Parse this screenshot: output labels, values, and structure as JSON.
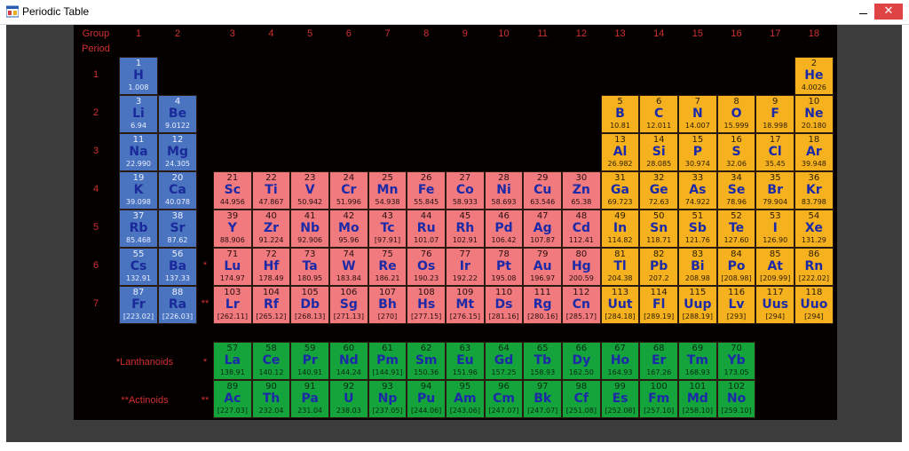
{
  "window": {
    "title": "Periodic Table",
    "close_glyph": "✕"
  },
  "labels": {
    "group": "Group",
    "period": "Period",
    "lanthanoids": "*Lanthanoids",
    "actinoids": "**Actinoids",
    "lan_marker": "*",
    "act_marker": "**"
  },
  "groups": [
    "1",
    "2",
    "3",
    "4",
    "5",
    "6",
    "7",
    "8",
    "9",
    "10",
    "11",
    "12",
    "13",
    "14",
    "15",
    "16",
    "17",
    "18"
  ],
  "periods": [
    "1",
    "2",
    "3",
    "4",
    "5",
    "6",
    "7"
  ],
  "colors": {
    "s_block": "#4a73c0",
    "d_block": "#f07a7e",
    "p_block": "#f6b21e",
    "f_block": "#15a33c",
    "background": "#050000",
    "label": "#d03030"
  },
  "elements": [
    {
      "n": "1",
      "s": "H",
      "m": "1.008",
      "g": 1,
      "p": 1,
      "b": "s"
    },
    {
      "n": "2",
      "s": "He",
      "m": "4.0026",
      "g": 18,
      "p": 1,
      "b": "p"
    },
    {
      "n": "3",
      "s": "Li",
      "m": "6.94",
      "g": 1,
      "p": 2,
      "b": "s"
    },
    {
      "n": "4",
      "s": "Be",
      "m": "9.0122",
      "g": 2,
      "p": 2,
      "b": "s"
    },
    {
      "n": "5",
      "s": "B",
      "m": "10.81",
      "g": 13,
      "p": 2,
      "b": "p"
    },
    {
      "n": "6",
      "s": "C",
      "m": "12.011",
      "g": 14,
      "p": 2,
      "b": "p"
    },
    {
      "n": "7",
      "s": "N",
      "m": "14.007",
      "g": 15,
      "p": 2,
      "b": "p"
    },
    {
      "n": "8",
      "s": "O",
      "m": "15.999",
      "g": 16,
      "p": 2,
      "b": "p"
    },
    {
      "n": "9",
      "s": "F",
      "m": "18.998",
      "g": 17,
      "p": 2,
      "b": "p"
    },
    {
      "n": "10",
      "s": "Ne",
      "m": "20.180",
      "g": 18,
      "p": 2,
      "b": "p"
    },
    {
      "n": "11",
      "s": "Na",
      "m": "22.990",
      "g": 1,
      "p": 3,
      "b": "s"
    },
    {
      "n": "12",
      "s": "Mg",
      "m": "24.305",
      "g": 2,
      "p": 3,
      "b": "s"
    },
    {
      "n": "13",
      "s": "Al",
      "m": "26.982",
      "g": 13,
      "p": 3,
      "b": "p"
    },
    {
      "n": "14",
      "s": "Si",
      "m": "28.085",
      "g": 14,
      "p": 3,
      "b": "p"
    },
    {
      "n": "15",
      "s": "P",
      "m": "30.974",
      "g": 15,
      "p": 3,
      "b": "p"
    },
    {
      "n": "16",
      "s": "S",
      "m": "32.06",
      "g": 16,
      "p": 3,
      "b": "p"
    },
    {
      "n": "17",
      "s": "Cl",
      "m": "35.45",
      "g": 17,
      "p": 3,
      "b": "p"
    },
    {
      "n": "18",
      "s": "Ar",
      "m": "39.948",
      "g": 18,
      "p": 3,
      "b": "p"
    },
    {
      "n": "19",
      "s": "K",
      "m": "39.098",
      "g": 1,
      "p": 4,
      "b": "s"
    },
    {
      "n": "20",
      "s": "Ca",
      "m": "40.078",
      "g": 2,
      "p": 4,
      "b": "s"
    },
    {
      "n": "21",
      "s": "Sc",
      "m": "44.956",
      "g": 3,
      "p": 4,
      "b": "d"
    },
    {
      "n": "22",
      "s": "Ti",
      "m": "47.867",
      "g": 4,
      "p": 4,
      "b": "d"
    },
    {
      "n": "23",
      "s": "V",
      "m": "50.942",
      "g": 5,
      "p": 4,
      "b": "d"
    },
    {
      "n": "24",
      "s": "Cr",
      "m": "51.996",
      "g": 6,
      "p": 4,
      "b": "d"
    },
    {
      "n": "25",
      "s": "Mn",
      "m": "54.938",
      "g": 7,
      "p": 4,
      "b": "d"
    },
    {
      "n": "26",
      "s": "Fe",
      "m": "55.845",
      "g": 8,
      "p": 4,
      "b": "d"
    },
    {
      "n": "27",
      "s": "Co",
      "m": "58.933",
      "g": 9,
      "p": 4,
      "b": "d"
    },
    {
      "n": "28",
      "s": "Ni",
      "m": "58.693",
      "g": 10,
      "p": 4,
      "b": "d"
    },
    {
      "n": "29",
      "s": "Cu",
      "m": "63.546",
      "g": 11,
      "p": 4,
      "b": "d"
    },
    {
      "n": "30",
      "s": "Zn",
      "m": "65.38",
      "g": 12,
      "p": 4,
      "b": "d"
    },
    {
      "n": "31",
      "s": "Ga",
      "m": "69.723",
      "g": 13,
      "p": 4,
      "b": "p"
    },
    {
      "n": "32",
      "s": "Ge",
      "m": "72.63",
      "g": 14,
      "p": 4,
      "b": "p"
    },
    {
      "n": "33",
      "s": "As",
      "m": "74.922",
      "g": 15,
      "p": 4,
      "b": "p"
    },
    {
      "n": "34",
      "s": "Se",
      "m": "78.96",
      "g": 16,
      "p": 4,
      "b": "p"
    },
    {
      "n": "35",
      "s": "Br",
      "m": "79.904",
      "g": 17,
      "p": 4,
      "b": "p"
    },
    {
      "n": "36",
      "s": "Kr",
      "m": "83.798",
      "g": 18,
      "p": 4,
      "b": "p"
    },
    {
      "n": "37",
      "s": "Rb",
      "m": "85.468",
      "g": 1,
      "p": 5,
      "b": "s"
    },
    {
      "n": "38",
      "s": "Sr",
      "m": "87.62",
      "g": 2,
      "p": 5,
      "b": "s"
    },
    {
      "n": "39",
      "s": "Y",
      "m": "88.906",
      "g": 3,
      "p": 5,
      "b": "d"
    },
    {
      "n": "40",
      "s": "Zr",
      "m": "91.224",
      "g": 4,
      "p": 5,
      "b": "d"
    },
    {
      "n": "41",
      "s": "Nb",
      "m": "92.906",
      "g": 5,
      "p": 5,
      "b": "d"
    },
    {
      "n": "42",
      "s": "Mo",
      "m": "95.96",
      "g": 6,
      "p": 5,
      "b": "d"
    },
    {
      "n": "43",
      "s": "Tc",
      "m": "[97.91]",
      "g": 7,
      "p": 5,
      "b": "d"
    },
    {
      "n": "44",
      "s": "Ru",
      "m": "101.07",
      "g": 8,
      "p": 5,
      "b": "d"
    },
    {
      "n": "45",
      "s": "Rh",
      "m": "102.91",
      "g": 9,
      "p": 5,
      "b": "d"
    },
    {
      "n": "46",
      "s": "Pd",
      "m": "106.42",
      "g": 10,
      "p": 5,
      "b": "d"
    },
    {
      "n": "47",
      "s": "Ag",
      "m": "107.87",
      "g": 11,
      "p": 5,
      "b": "d"
    },
    {
      "n": "48",
      "s": "Cd",
      "m": "112.41",
      "g": 12,
      "p": 5,
      "b": "d"
    },
    {
      "n": "49",
      "s": "In",
      "m": "114.82",
      "g": 13,
      "p": 5,
      "b": "p"
    },
    {
      "n": "50",
      "s": "Sn",
      "m": "118.71",
      "g": 14,
      "p": 5,
      "b": "p"
    },
    {
      "n": "51",
      "s": "Sb",
      "m": "121.76",
      "g": 15,
      "p": 5,
      "b": "p"
    },
    {
      "n": "52",
      "s": "Te",
      "m": "127.60",
      "g": 16,
      "p": 5,
      "b": "p"
    },
    {
      "n": "53",
      "s": "I",
      "m": "126.90",
      "g": 17,
      "p": 5,
      "b": "p"
    },
    {
      "n": "54",
      "s": "Xe",
      "m": "131.29",
      "g": 18,
      "p": 5,
      "b": "p"
    },
    {
      "n": "55",
      "s": "Cs",
      "m": "132.91",
      "g": 1,
      "p": 6,
      "b": "s"
    },
    {
      "n": "56",
      "s": "Ba",
      "m": "137.33",
      "g": 2,
      "p": 6,
      "b": "s"
    },
    {
      "n": "71",
      "s": "Lu",
      "m": "174.97",
      "g": 3,
      "p": 6,
      "b": "d"
    },
    {
      "n": "72",
      "s": "Hf",
      "m": "178.49",
      "g": 4,
      "p": 6,
      "b": "d"
    },
    {
      "n": "73",
      "s": "Ta",
      "m": "180.95",
      "g": 5,
      "p": 6,
      "b": "d"
    },
    {
      "n": "74",
      "s": "W",
      "m": "183.84",
      "g": 6,
      "p": 6,
      "b": "d"
    },
    {
      "n": "75",
      "s": "Re",
      "m": "186.21",
      "g": 7,
      "p": 6,
      "b": "d"
    },
    {
      "n": "76",
      "s": "Os",
      "m": "190.23",
      "g": 8,
      "p": 6,
      "b": "d"
    },
    {
      "n": "77",
      "s": "Ir",
      "m": "192.22",
      "g": 9,
      "p": 6,
      "b": "d"
    },
    {
      "n": "78",
      "s": "Pt",
      "m": "195.08",
      "g": 10,
      "p": 6,
      "b": "d"
    },
    {
      "n": "79",
      "s": "Au",
      "m": "196.97",
      "g": 11,
      "p": 6,
      "b": "d"
    },
    {
      "n": "80",
      "s": "Hg",
      "m": "200.59",
      "g": 12,
      "p": 6,
      "b": "d"
    },
    {
      "n": "81",
      "s": "Tl",
      "m": "204.38",
      "g": 13,
      "p": 6,
      "b": "p"
    },
    {
      "n": "82",
      "s": "Pb",
      "m": "207.2",
      "g": 14,
      "p": 6,
      "b": "p"
    },
    {
      "n": "83",
      "s": "Bi",
      "m": "208.98",
      "g": 15,
      "p": 6,
      "b": "p"
    },
    {
      "n": "84",
      "s": "Po",
      "m": "[208.98]",
      "g": 16,
      "p": 6,
      "b": "p"
    },
    {
      "n": "85",
      "s": "At",
      "m": "[209.99]",
      "g": 17,
      "p": 6,
      "b": "p"
    },
    {
      "n": "86",
      "s": "Rn",
      "m": "[222.02]",
      "g": 18,
      "p": 6,
      "b": "p"
    },
    {
      "n": "87",
      "s": "Fr",
      "m": "[223.02]",
      "g": 1,
      "p": 7,
      "b": "s"
    },
    {
      "n": "88",
      "s": "Ra",
      "m": "[226.03]",
      "g": 2,
      "p": 7,
      "b": "s"
    },
    {
      "n": "103",
      "s": "Lr",
      "m": "[262.11]",
      "g": 3,
      "p": 7,
      "b": "d"
    },
    {
      "n": "104",
      "s": "Rf",
      "m": "[265.12]",
      "g": 4,
      "p": 7,
      "b": "d"
    },
    {
      "n": "105",
      "s": "Db",
      "m": "[268.13]",
      "g": 5,
      "p": 7,
      "b": "d"
    },
    {
      "n": "106",
      "s": "Sg",
      "m": "[271.13]",
      "g": 6,
      "p": 7,
      "b": "d"
    },
    {
      "n": "107",
      "s": "Bh",
      "m": "[270]",
      "g": 7,
      "p": 7,
      "b": "d"
    },
    {
      "n": "108",
      "s": "Hs",
      "m": "[277.15]",
      "g": 8,
      "p": 7,
      "b": "d"
    },
    {
      "n": "109",
      "s": "Mt",
      "m": "[276.15]",
      "g": 9,
      "p": 7,
      "b": "d"
    },
    {
      "n": "110",
      "s": "Ds",
      "m": "[281.16]",
      "g": 10,
      "p": 7,
      "b": "d"
    },
    {
      "n": "111",
      "s": "Rg",
      "m": "[280.16]",
      "g": 11,
      "p": 7,
      "b": "d"
    },
    {
      "n": "112",
      "s": "Cn",
      "m": "[285.17]",
      "g": 12,
      "p": 7,
      "b": "d"
    },
    {
      "n": "113",
      "s": "Uut",
      "m": "[284.18]",
      "g": 13,
      "p": 7,
      "b": "p"
    },
    {
      "n": "114",
      "s": "Fl",
      "m": "[289.19]",
      "g": 14,
      "p": 7,
      "b": "p"
    },
    {
      "n": "115",
      "s": "Uup",
      "m": "[288.19]",
      "g": 15,
      "p": 7,
      "b": "p"
    },
    {
      "n": "116",
      "s": "Lv",
      "m": "[293]",
      "g": 16,
      "p": 7,
      "b": "p"
    },
    {
      "n": "117",
      "s": "Uus",
      "m": "[294]",
      "g": 17,
      "p": 7,
      "b": "p"
    },
    {
      "n": "118",
      "s": "Uuo",
      "m": "[294]",
      "g": 18,
      "p": 7,
      "b": "p"
    },
    {
      "n": "57",
      "s": "La",
      "m": "138.91",
      "g": 3,
      "p": 8,
      "b": "f"
    },
    {
      "n": "58",
      "s": "Ce",
      "m": "140.12",
      "g": 4,
      "p": 8,
      "b": "f"
    },
    {
      "n": "59",
      "s": "Pr",
      "m": "140.91",
      "g": 5,
      "p": 8,
      "b": "f"
    },
    {
      "n": "60",
      "s": "Nd",
      "m": "144.24",
      "g": 6,
      "p": 8,
      "b": "f"
    },
    {
      "n": "61",
      "s": "Pm",
      "m": "[144.91]",
      "g": 7,
      "p": 8,
      "b": "f"
    },
    {
      "n": "62",
      "s": "Sm",
      "m": "150.36",
      "g": 8,
      "p": 8,
      "b": "f"
    },
    {
      "n": "63",
      "s": "Eu",
      "m": "151.96",
      "g": 9,
      "p": 8,
      "b": "f"
    },
    {
      "n": "64",
      "s": "Gd",
      "m": "157.25",
      "g": 10,
      "p": 8,
      "b": "f"
    },
    {
      "n": "65",
      "s": "Tb",
      "m": "158.93",
      "g": 11,
      "p": 8,
      "b": "f"
    },
    {
      "n": "66",
      "s": "Dy",
      "m": "162.50",
      "g": 12,
      "p": 8,
      "b": "f"
    },
    {
      "n": "67",
      "s": "Ho",
      "m": "164.93",
      "g": 13,
      "p": 8,
      "b": "f"
    },
    {
      "n": "68",
      "s": "Er",
      "m": "167.26",
      "g": 14,
      "p": 8,
      "b": "f"
    },
    {
      "n": "69",
      "s": "Tm",
      "m": "168.93",
      "g": 15,
      "p": 8,
      "b": "f"
    },
    {
      "n": "70",
      "s": "Yb",
      "m": "173.05",
      "g": 16,
      "p": 8,
      "b": "f"
    },
    {
      "n": "89",
      "s": "Ac",
      "m": "[227.03]",
      "g": 3,
      "p": 9,
      "b": "f"
    },
    {
      "n": "90",
      "s": "Th",
      "m": "232.04",
      "g": 4,
      "p": 9,
      "b": "f"
    },
    {
      "n": "91",
      "s": "Pa",
      "m": "231.04",
      "g": 5,
      "p": 9,
      "b": "f"
    },
    {
      "n": "92",
      "s": "U",
      "m": "238.03",
      "g": 6,
      "p": 9,
      "b": "f"
    },
    {
      "n": "93",
      "s": "Np",
      "m": "[237.05]",
      "g": 7,
      "p": 9,
      "b": "f"
    },
    {
      "n": "94",
      "s": "Pu",
      "m": "[244.06]",
      "g": 8,
      "p": 9,
      "b": "f"
    },
    {
      "n": "95",
      "s": "Am",
      "m": "[243.06]",
      "g": 9,
      "p": 9,
      "b": "f"
    },
    {
      "n": "96",
      "s": "Cm",
      "m": "[247.07]",
      "g": 10,
      "p": 9,
      "b": "f"
    },
    {
      "n": "97",
      "s": "Bk",
      "m": "[247.07]",
      "g": 11,
      "p": 9,
      "b": "f"
    },
    {
      "n": "98",
      "s": "Cf",
      "m": "[251.08]",
      "g": 12,
      "p": 9,
      "b": "f"
    },
    {
      "n": "99",
      "s": "Es",
      "m": "[252.08]",
      "g": 13,
      "p": 9,
      "b": "f"
    },
    {
      "n": "100",
      "s": "Fm",
      "m": "[257.10]",
      "g": 14,
      "p": 9,
      "b": "f"
    },
    {
      "n": "101",
      "s": "Md",
      "m": "[258.10]",
      "g": 15,
      "p": 9,
      "b": "f"
    },
    {
      "n": "102",
      "s": "No",
      "m": "[259.10]",
      "g": 16,
      "p": 9,
      "b": "f"
    }
  ]
}
